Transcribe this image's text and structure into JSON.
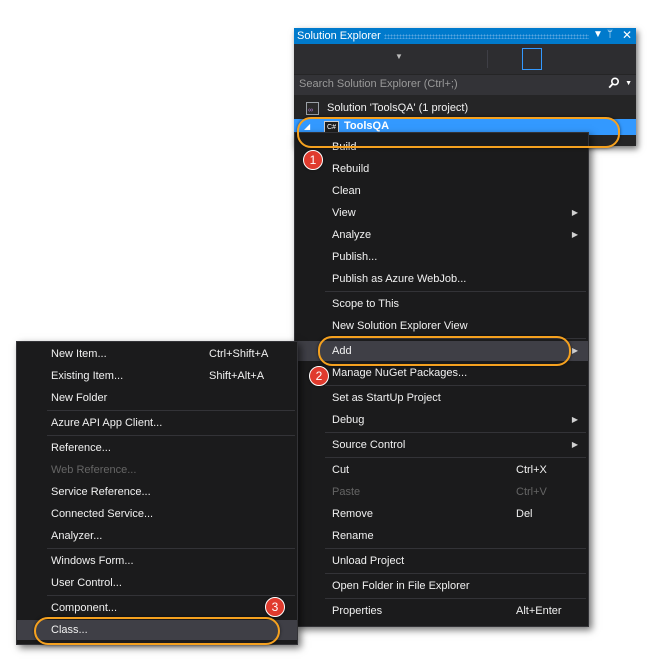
{
  "solution_explorer": {
    "title": "Solution Explorer",
    "dropdown_icon": "triangle-down",
    "pin_icon": "pin",
    "close_icon": "close",
    "search_placeholder": "Search Solution Explorer (Ctrl+;)",
    "search_icon": "magnifier",
    "solution_label": "Solution 'ToolsQA' (1 project)",
    "project_label": "ToolsQA",
    "project_icon_text": "C#"
  },
  "context_menu": {
    "items": [
      {
        "label": "Build"
      },
      {
        "label": "Rebuild"
      },
      {
        "label": "Clean"
      },
      {
        "label": "View",
        "submenu": true
      },
      {
        "label": "Analyze",
        "submenu": true
      },
      {
        "label": "Publish..."
      },
      {
        "label": "Publish as Azure WebJob..."
      },
      {
        "label": "Scope to This"
      },
      {
        "label": "New Solution Explorer View"
      },
      {
        "label": "Add",
        "submenu": true,
        "highlighted": true
      },
      {
        "label": "Manage NuGet Packages..."
      },
      {
        "label": "Set as StartUp Project"
      },
      {
        "label": "Debug",
        "submenu": true
      },
      {
        "label": "Source Control",
        "submenu": true
      },
      {
        "label": "Cut",
        "shortcut": "Ctrl+X"
      },
      {
        "label": "Paste",
        "shortcut": "Ctrl+V",
        "disabled": true
      },
      {
        "label": "Remove",
        "shortcut": "Del"
      },
      {
        "label": "Rename"
      },
      {
        "label": "Unload Project"
      },
      {
        "label": "Open Folder in File Explorer"
      },
      {
        "label": "Properties",
        "shortcut": "Alt+Enter"
      }
    ]
  },
  "add_submenu": {
    "items": [
      {
        "label": "New Item...",
        "shortcut": "Ctrl+Shift+A"
      },
      {
        "label": "Existing Item...",
        "shortcut": "Shift+Alt+A"
      },
      {
        "label": "New Folder"
      },
      {
        "label": "Azure API App Client..."
      },
      {
        "label": "Reference..."
      },
      {
        "label": "Web Reference...",
        "disabled": true
      },
      {
        "label": "Service Reference..."
      },
      {
        "label": "Connected Service..."
      },
      {
        "label": "Analyzer..."
      },
      {
        "label": "Windows Form..."
      },
      {
        "label": "User Control..."
      },
      {
        "label": "Component..."
      },
      {
        "label": "Class...",
        "highlighted": true
      }
    ]
  },
  "annotations": {
    "step1": "1",
    "step2": "2",
    "step3": "3",
    "ring_color": "#f5a11f",
    "badge_color": "#e03b2e"
  },
  "colors": {
    "accent": "#007acc",
    "selection": "#3399ff",
    "menu_bg": "#1b1b1c"
  }
}
